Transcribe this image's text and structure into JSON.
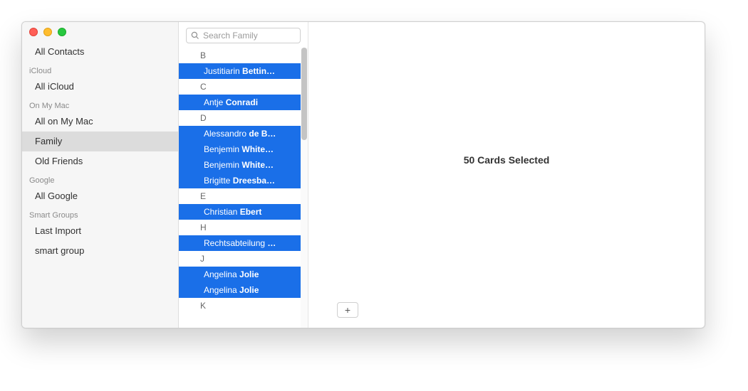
{
  "sidebar": {
    "all_contacts": "All Contacts",
    "headers": {
      "icloud": "iCloud",
      "onmymac": "On My Mac",
      "google": "Google",
      "smart": "Smart Groups"
    },
    "items": {
      "all_icloud": "All iCloud",
      "all_on_my_mac": "All on My Mac",
      "family": "Family",
      "old_friends": "Old Friends",
      "all_google": "All Google",
      "last_import": "Last Import",
      "smart_group": "smart group"
    }
  },
  "search": {
    "placeholder": "Search Family"
  },
  "list": {
    "sections": [
      {
        "letter": "B",
        "rows": [
          {
            "first": "Justitiarin",
            "bold": "Bettin…"
          }
        ]
      },
      {
        "letter": "C",
        "rows": [
          {
            "first": "Antje",
            "bold": "Conradi"
          }
        ]
      },
      {
        "letter": "D",
        "rows": [
          {
            "first": "Alessandro",
            "bold": "de B…"
          },
          {
            "first": "Benjemin",
            "bold": "White…"
          },
          {
            "first": "Benjemin",
            "bold": "White…"
          },
          {
            "first": "Brigitte",
            "bold": "Dreesba…"
          }
        ]
      },
      {
        "letter": "E",
        "rows": [
          {
            "first": "Christian",
            "bold": "Ebert"
          }
        ]
      },
      {
        "letter": "H",
        "rows": [
          {
            "first": "Rechtsabteilung",
            "bold": "…"
          }
        ]
      },
      {
        "letter": "J",
        "rows": [
          {
            "first": "Angelina",
            "bold": "Jolie"
          },
          {
            "first": "Angelina",
            "bold": "Jolie"
          }
        ]
      },
      {
        "letter": "K",
        "rows": []
      }
    ]
  },
  "detail": {
    "message": "50 Cards Selected"
  },
  "buttons": {
    "add": "+"
  }
}
